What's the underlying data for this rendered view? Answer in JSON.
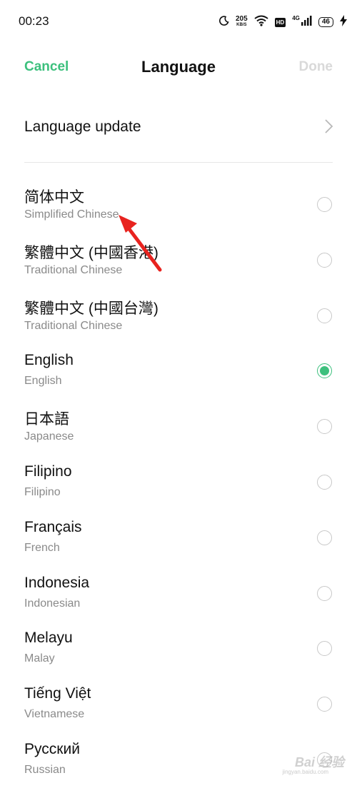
{
  "status_bar": {
    "time": "00:23",
    "speed_value": "205",
    "speed_unit": "KB/S",
    "hd_label": "HD",
    "network_label": "4G",
    "battery": "46",
    "icons": [
      "moon-icon",
      "wifi-icon",
      "signal-icon",
      "battery-icon",
      "charging-icon"
    ]
  },
  "nav": {
    "cancel_label": "Cancel",
    "title": "Language",
    "done_label": "Done"
  },
  "language_update": {
    "label": "Language update"
  },
  "languages": [
    {
      "name": "简体中文",
      "sub": "Simplified Chinese",
      "selected": false
    },
    {
      "name": "繁體中文 (中國香港)",
      "sub": "Traditional Chinese",
      "selected": false
    },
    {
      "name": "繁體中文 (中國台灣)",
      "sub": "Traditional Chinese",
      "selected": false
    },
    {
      "name": "English",
      "sub": "English",
      "selected": true
    },
    {
      "name": "日本語",
      "sub": "Japanese",
      "selected": false
    },
    {
      "name": "Filipino",
      "sub": "Filipino",
      "selected": false
    },
    {
      "name": "Français",
      "sub": "French",
      "selected": false
    },
    {
      "name": "Indonesia",
      "sub": "Indonesian",
      "selected": false
    },
    {
      "name": "Melayu",
      "sub": "Malay",
      "selected": false
    },
    {
      "name": "Tiếng Việt",
      "sub": "Vietnamese",
      "selected": false
    },
    {
      "name": "Русский",
      "sub": "Russian",
      "selected": false
    }
  ],
  "colors": {
    "accent": "#3cc07d",
    "disabled": "#d9d9d9",
    "annotation": "#e8231f"
  },
  "watermark": {
    "text": "Bai 经验",
    "sub": "jingyan.baidu.com"
  }
}
